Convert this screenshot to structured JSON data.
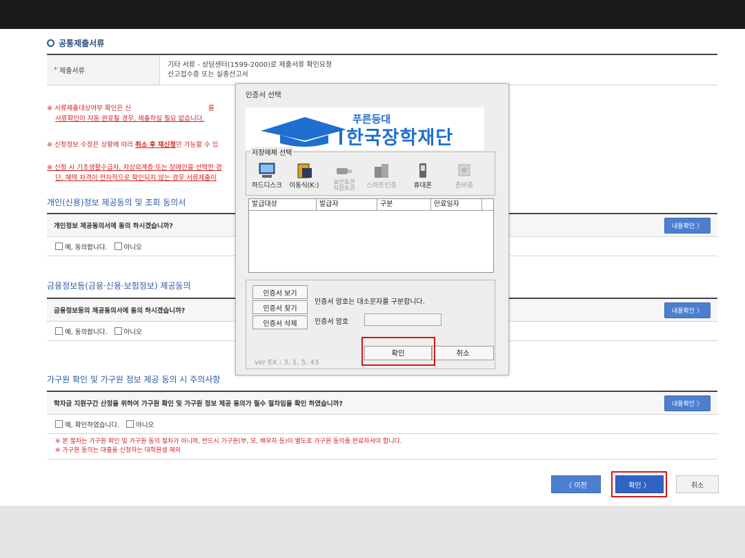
{
  "common_docs": {
    "section_title": "공통제출서류",
    "row_label": "제출서류",
    "row_line1": "기타 서류 - 상담센터(1599-2000)로 제출서류 확인요청",
    "row_line2": "신고접수증 또는 실종선고서"
  },
  "notes": {
    "note1_a": "※ 서류제출대상여부 확인은 신",
    "note1_b": "를",
    "note1_line2": "서류확인이 자동 완료될 경우, 제출하실 필요 없습니다.",
    "note2_a": "※ 신청정보 수정은 상황에 따라 ",
    "note2_u": "취소 후 재신청",
    "note2_b": "만 가능할 수 있",
    "note3_line1": "※ 신청 시 기초생활수급자, 자상외계층 또는 장애인을 선택한 경",
    "note3_line2": "단, 혜택 자격이 전자적으로 확인되지 않는 경우 서류제출이"
  },
  "personal_consent": {
    "title": "개인(신용)정보 제공동의 및 조회 동의서",
    "question": "개인정보 제공동의서에 동의 하시겠습니까?",
    "detail_button": "내용확인 〉",
    "opt_yes": "예, 동의합니다.",
    "opt_no": "아니오"
  },
  "financial_consent": {
    "title": "금융정보등(금융·신용·보험정보) 제공동의",
    "question": "금융정보등의 제공동의서에 동의 하시겠습니까?",
    "detail_button": "내용확인 〉",
    "opt_yes": "예, 동의합니다.",
    "opt_no": "아니오"
  },
  "family_consent": {
    "title": "가구원 확인 및 가구원 정보 제공 동의 시 주의사항",
    "question": "학자금 지원구간 산정을 위하여 가구원 확인 및 가구원 정보 제공 동의가 필수 절차임을 확인 하였습니까?",
    "detail_button": "내용확인 〉",
    "opt_yes": "예, 확인하였습니다.",
    "opt_no": "아니오",
    "caution1": "※ 본 절차는 가구원 확인 및 가구원 동의 절차가 아니며, 반드시 가구원(부, 모, 배우자 등)이 별도로 가구원 동의를 완료하셔야 합니다.",
    "caution2": "※ 가구원 동의는 대출을 신청하는 대학원생 제외"
  },
  "nav": {
    "prev": "〈  이전",
    "next": "확인  〉",
    "cancel": "취소"
  },
  "cert_dialog": {
    "title": "인증서 선택",
    "banner_small": "푸른등대",
    "banner_big": "한국장학재단",
    "media_group_label": "저장매체 선택",
    "media": [
      {
        "label": "하드디스크",
        "icon": "hard-disk-icon",
        "enabled": true
      },
      {
        "label": "이동식(K:)",
        "icon": "removable-disk-icon",
        "enabled": true
      },
      {
        "label": "보안토큰\n저장토큰",
        "icon": "security-token-icon",
        "enabled": false
      },
      {
        "label": "스마트인증",
        "icon": "smart-auth-icon",
        "enabled": false
      },
      {
        "label": "휴대폰",
        "icon": "mobile-phone-icon",
        "enabled": true
      },
      {
        "label": "준비중",
        "icon": "preparing-icon",
        "enabled": false
      }
    ],
    "columns": [
      "발급대상",
      "발급자",
      "구분",
      "만료일자"
    ],
    "view_cert": "인증서 보기",
    "find_cert": "인증서 찾기",
    "delete_cert": "인증서 삭제",
    "case_note": "인증서 암호는 대소문자를 구분합니다.",
    "password_label": "인증서 암호",
    "ok": "확인",
    "cancel": "취소",
    "version": "ver EX : 3, 1, 5, 43"
  },
  "colors": {
    "accent_blue": "#4d7fcf",
    "highlight_red": "#d81414",
    "note_red": "#d62020"
  }
}
